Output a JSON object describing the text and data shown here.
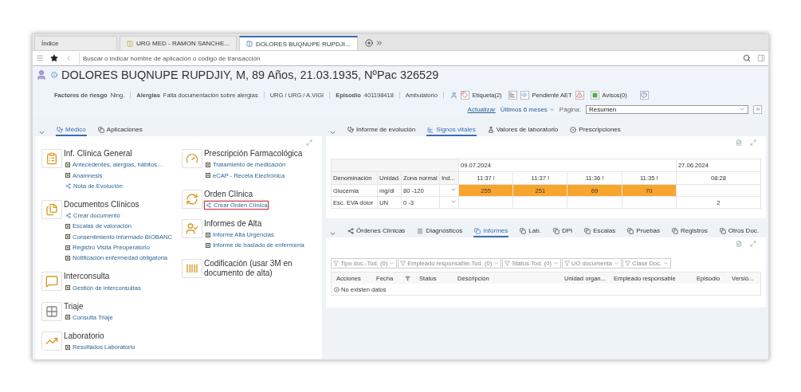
{
  "browser_tabs": [
    {
      "label": "Índice",
      "selected": false
    },
    {
      "label": "URG MED - RAMON SANCHE...",
      "selected": false
    },
    {
      "label": "DOLORES BUQNUPE RUPDJI...",
      "selected": true
    }
  ],
  "address_bar": {
    "placeholder": "Buscar o indicar nombre de aplicación o código de transacción"
  },
  "patient": {
    "title": "DOLORES BUQNUPE RUPDJIY, M, 89 Años, 21.03.1935, NºPac 326529",
    "facts": [
      {
        "label": "Factores de riesgo",
        "value": "Ning."
      },
      {
        "label": "Alergias",
        "value": "Falta documentación sobre alergias"
      },
      {
        "value": "URG / URG / A.VIGI"
      },
      {
        "label": "Episodio",
        "value": "401198418"
      },
      {
        "value": "Ambulatorio"
      }
    ],
    "badges": [
      {
        "kind": "tag",
        "label": "Etiqueta(2)"
      },
      {
        "kind": "pending",
        "label": "Pendiente AET"
      },
      {
        "kind": "notice",
        "label": "Avisos(0)"
      }
    ]
  },
  "view": {
    "refresh_link": "Actualizar",
    "period": "Últimos 6 meses",
    "page_label": "Página:",
    "page_value": "Resumen"
  },
  "left_panel": {
    "tabs": [
      {
        "label": "Médico",
        "selected": true
      },
      {
        "label": "Aplicaciones",
        "selected": false
      }
    ],
    "tile_columns": [
      [
        {
          "title": "Inf. Clínica General",
          "links": [
            {
              "kind": "doc",
              "label": "Antecedentes, alergias, hábitos...",
              "highlighted": false
            },
            {
              "kind": "doc",
              "label": "Anamnesis",
              "highlighted": false
            },
            {
              "kind": "share",
              "label": "Nota de Evolución",
              "highlighted": false
            }
          ]
        },
        {
          "title": "Documentos Clínicos",
          "links": [
            {
              "kind": "share",
              "label": "Crear documento",
              "highlighted": false
            },
            {
              "kind": "doc",
              "label": "Escalas de valoración",
              "highlighted": false
            },
            {
              "kind": "doc",
              "label": "Consentimiento informado BIOBANC",
              "highlighted": false
            },
            {
              "kind": "doc",
              "label": "Registro Visita Preoperatorio",
              "highlighted": false
            },
            {
              "kind": "doc",
              "label": "Notificación enfermedad obligatoria",
              "highlighted": false
            }
          ]
        },
        {
          "title": "Interconsulta",
          "links": [
            {
              "kind": "doc",
              "label": "Gestión de interconsultas",
              "highlighted": false
            }
          ]
        },
        {
          "title": "Triaje",
          "links": [
            {
              "kind": "doc",
              "label": "Consulta Triaje",
              "highlighted": false
            }
          ]
        },
        {
          "title": "Laboratorio",
          "links": [
            {
              "kind": "doc",
              "label": "Resultados Laboratorio",
              "highlighted": false
            }
          ]
        }
      ],
      [
        {
          "title": "Prescripción Farmacológica",
          "links": [
            {
              "kind": "doc",
              "label": "Tratamiento de medicación",
              "highlighted": false
            },
            {
              "kind": "doc",
              "label": "eCAP - Receta Electrónica",
              "highlighted": false
            }
          ]
        },
        {
          "title": "Orden Clínica",
          "links": [
            {
              "kind": "share",
              "label": "Crear Orden Clínica",
              "highlighted": true
            }
          ]
        },
        {
          "title": "Informes de Alta",
          "links": [
            {
              "kind": "doc",
              "label": "Informe Alta Urgencias",
              "highlighted": false
            },
            {
              "kind": "doc",
              "label": "Informe de traslado de enfermería",
              "highlighted": false
            }
          ]
        },
        {
          "title": "Codificación (usar 3M en documento de alta)"
        }
      ]
    ]
  },
  "vitals_panel": {
    "tabs": [
      {
        "label": "Informe de evolución",
        "selected": false
      },
      {
        "label": "Signos vitales",
        "selected": true
      },
      {
        "label": "Valores de laboratorio",
        "selected": false
      },
      {
        "label": "Prescripciones",
        "selected": false
      }
    ],
    "columns": [
      "Denominación",
      "Unidad",
      "Zona normal",
      "Ind..."
    ],
    "date_groups": [
      {
        "date": "09.07.2024",
        "times": [
          "11:37 !",
          "11:37 !",
          "11:36 !",
          "11:35 !"
        ]
      },
      {
        "date": "27.06.2024",
        "times": [
          "08:28"
        ]
      }
    ],
    "rows": [
      {
        "name": "Glucemia",
        "unit": "mg/dl",
        "range": "80 -120",
        "values": [
          {
            "text": "255",
            "alert": true
          },
          {
            "text": "251",
            "alert": true
          },
          {
            "text": "69",
            "alert": true
          },
          {
            "text": "70",
            "alert": true
          },
          {
            "alert": false
          }
        ]
      },
      {
        "name": "Esc. EVA dolor",
        "unit": "UN",
        "range": "0 -3",
        "values": [
          {
            "alert": false
          },
          {
            "alert": false
          },
          {
            "alert": false
          },
          {
            "alert": false
          },
          {
            "text": "2",
            "alert": false
          }
        ]
      }
    ]
  },
  "reports_panel": {
    "tabs": [
      {
        "label": "Órdenes Clínicas",
        "selected": false
      },
      {
        "label": "Diagnósticos",
        "selected": false
      },
      {
        "label": "Informes",
        "selected": true
      },
      {
        "label": "Lab.",
        "selected": false
      },
      {
        "label": "DPI",
        "selected": false
      },
      {
        "label": "Escalas",
        "selected": false
      },
      {
        "label": "Pruebas",
        "selected": false
      },
      {
        "label": "Registros",
        "selected": false
      },
      {
        "label": "Otros Doc.",
        "selected": false
      }
    ],
    "filters": [
      "Tipo doc.-Tod. (0)",
      "Empleado responsable-Tod. (0)",
      "Status-Tod. (0)",
      "UO documenta",
      "Clase Doc."
    ],
    "columns": [
      {
        "kind": "text",
        "label": "Acciones"
      },
      {
        "kind": "text",
        "label": "Fecha"
      },
      {
        "kind": "filter"
      },
      {
        "kind": "text",
        "label": "Status"
      },
      {
        "kind": "text",
        "label": "Descripción"
      },
      {
        "kind": "text",
        "label": "Unidad organ..."
      },
      {
        "kind": "text",
        "label": "Empleado responsable"
      },
      {
        "kind": "text",
        "label": "Episodio"
      },
      {
        "kind": "text",
        "label": "Versió..."
      }
    ],
    "empty_message": "No existen datos"
  }
}
